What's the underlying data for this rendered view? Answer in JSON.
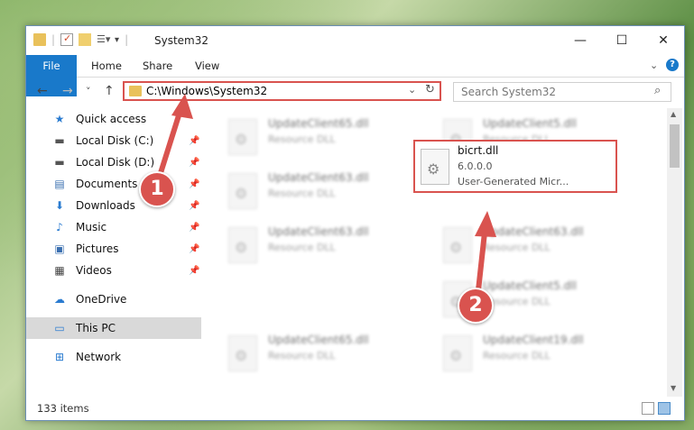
{
  "window": {
    "title": "System32",
    "controls": {
      "minimize": "—",
      "maximize": "☐",
      "close": "✕"
    }
  },
  "ribbon": {
    "tabs": [
      "File",
      "Home",
      "Share",
      "View"
    ],
    "help": "?"
  },
  "nav": {
    "back": "←",
    "forward": "→",
    "recent": "˅",
    "up": "↑",
    "address": "C:\\Windows\\System32",
    "search_placeholder": "Search System32"
  },
  "sidebar": {
    "items": [
      {
        "label": "Quick access",
        "icon": "star-icon",
        "glyph": "★",
        "pinned": false
      },
      {
        "label": "Local Disk (C:)",
        "icon": "drive-icon",
        "glyph": "▬",
        "pinned": true
      },
      {
        "label": "Local Disk (D:)",
        "icon": "drive-icon",
        "glyph": "▬",
        "pinned": true
      },
      {
        "label": "Documents",
        "icon": "documents-icon",
        "glyph": "▤",
        "pinned": true
      },
      {
        "label": "Downloads",
        "icon": "download-icon",
        "glyph": "⬇",
        "pinned": true
      },
      {
        "label": "Music",
        "icon": "music-icon",
        "glyph": "♪",
        "pinned": true
      },
      {
        "label": "Pictures",
        "icon": "pictures-icon",
        "glyph": "▣",
        "pinned": true
      },
      {
        "label": "Videos",
        "icon": "videos-icon",
        "glyph": "▦",
        "pinned": true
      },
      {
        "label": "OneDrive",
        "icon": "cloud-icon",
        "glyph": "☁",
        "pinned": false
      },
      {
        "label": "This PC",
        "icon": "computer-icon",
        "glyph": "▭",
        "pinned": false
      },
      {
        "label": "Network",
        "icon": "network-icon",
        "glyph": "⊞",
        "pinned": false
      }
    ]
  },
  "files": [
    {
      "name": "UpdateClient65.dll",
      "type": "Resource DLL"
    },
    {
      "name": "UpdateClient5.dll",
      "type": "Resource DLL"
    },
    {
      "name": "UpdateClient63.dll",
      "type": "Resource DLL"
    },
    {
      "name": "UpdateClient63.dll",
      "type": "Resource DLL"
    },
    {
      "name": "UpdateClient63.dll",
      "type": "Resource DLL"
    },
    {
      "name": "UpdateClient5.dll",
      "type": "Resource DLL"
    },
    {
      "name": "UpdateClient65.dll",
      "type": "Resource DLL"
    },
    {
      "name": "UpdateClient19.dll",
      "type": "Resource DLL"
    }
  ],
  "highlighted_file": {
    "name": "bicrt.dll",
    "version": "6.0.0.0",
    "description": "User-Generated Micr..."
  },
  "status": {
    "item_count": "133 items"
  },
  "callouts": {
    "step1": "1",
    "step2": "2"
  },
  "colors": {
    "accent": "#1979ca",
    "callout": "#d9534f"
  }
}
